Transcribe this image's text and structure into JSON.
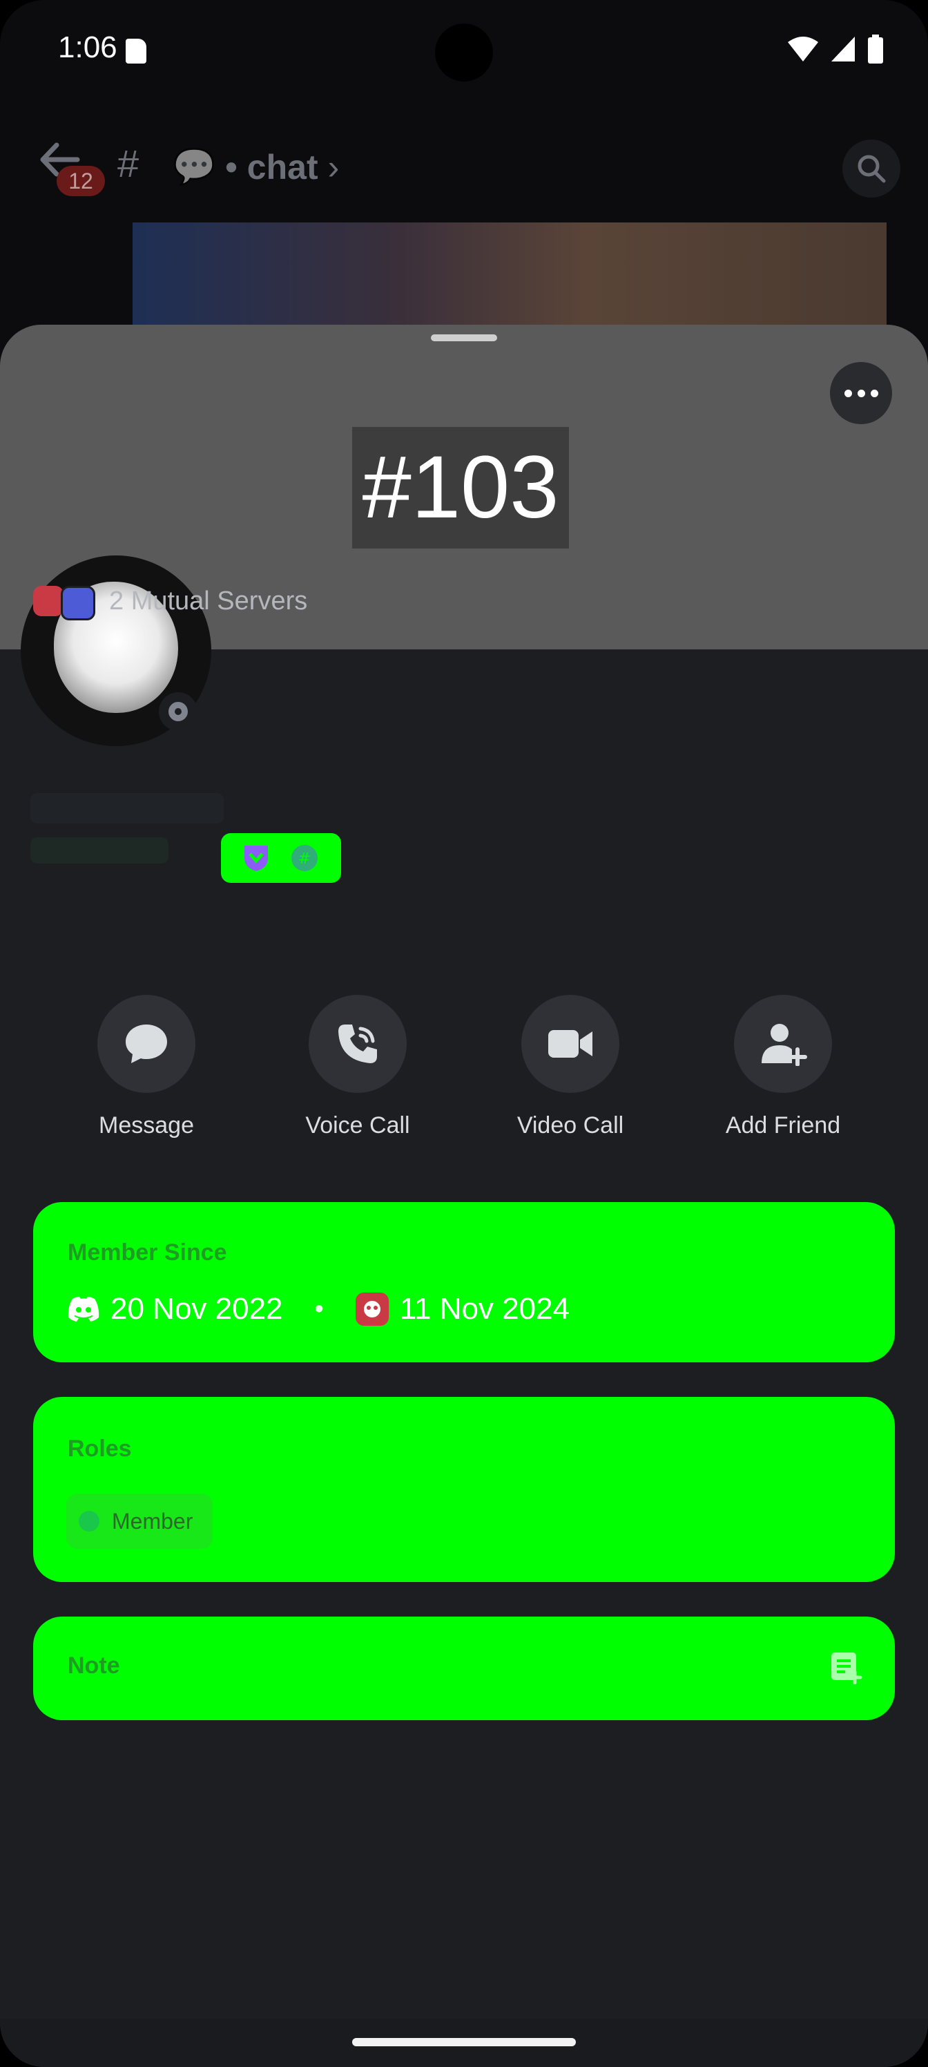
{
  "status_bar": {
    "time": "1:06"
  },
  "background_channel": {
    "unread_badge": "12",
    "hash": "#",
    "channel_emoji": "💬",
    "separator": "•",
    "channel_name": "chat",
    "chevron": "›"
  },
  "profile": {
    "banner_tag": "#103",
    "mutual_servers": "2 Mutual Servers",
    "actions": [
      {
        "label": "Message",
        "icon": "chat-bubble-icon"
      },
      {
        "label": "Voice Call",
        "icon": "phone-icon"
      },
      {
        "label": "Video Call",
        "icon": "video-camera-icon"
      },
      {
        "label": "Add Friend",
        "icon": "add-friend-icon"
      }
    ],
    "member_since": {
      "heading": "Member Since",
      "discord_date": "20 Nov 2022",
      "separator": "•",
      "server_date": "11 Nov 2024"
    },
    "roles": {
      "heading": "Roles",
      "items": [
        "Member"
      ]
    },
    "note": {
      "heading": "Note"
    }
  },
  "colors": {
    "sheet_bg": "#1d1e22",
    "banner_bg": "#5a5a5a",
    "highlight": "#00ff00",
    "action_circle": "#2f3136"
  }
}
